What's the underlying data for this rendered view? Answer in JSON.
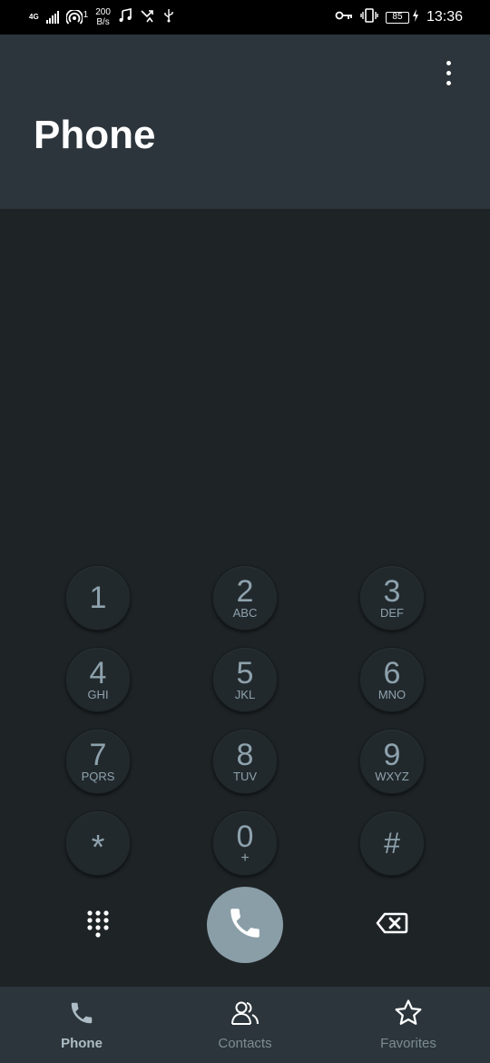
{
  "status_bar": {
    "network": "4G",
    "sim": "1",
    "speed_value": "200",
    "speed_unit": "B/s",
    "battery": "85",
    "time": "13:36"
  },
  "header": {
    "title": "Phone",
    "menu_icon": "more-vertical-icon"
  },
  "dialpad": {
    "keys": [
      {
        "digit": "1",
        "letters": ""
      },
      {
        "digit": "2",
        "letters": "ABC"
      },
      {
        "digit": "3",
        "letters": "DEF"
      },
      {
        "digit": "4",
        "letters": "GHI"
      },
      {
        "digit": "5",
        "letters": "JKL"
      },
      {
        "digit": "6",
        "letters": "MNO"
      },
      {
        "digit": "7",
        "letters": "PQRS"
      },
      {
        "digit": "8",
        "letters": "TUV"
      },
      {
        "digit": "9",
        "letters": "WXYZ"
      },
      {
        "digit": "*",
        "letters": ""
      },
      {
        "digit": "0",
        "letters": "+"
      },
      {
        "digit": "#",
        "letters": ""
      }
    ]
  },
  "actions": {
    "dialpad_icon": "dialpad-grid-icon",
    "call_icon": "phone-call-icon",
    "backspace_icon": "backspace-icon"
  },
  "bottom_nav": {
    "items": [
      {
        "label": "Phone",
        "icon": "phone-icon",
        "active": true
      },
      {
        "label": "Contacts",
        "icon": "contacts-icon",
        "active": false
      },
      {
        "label": "Favorites",
        "icon": "star-icon",
        "active": false
      }
    ]
  },
  "colors": {
    "background": "#1e2326",
    "header": "#2c353b",
    "accent": "#8a9ea8",
    "key_text": "#8ea2ad"
  }
}
